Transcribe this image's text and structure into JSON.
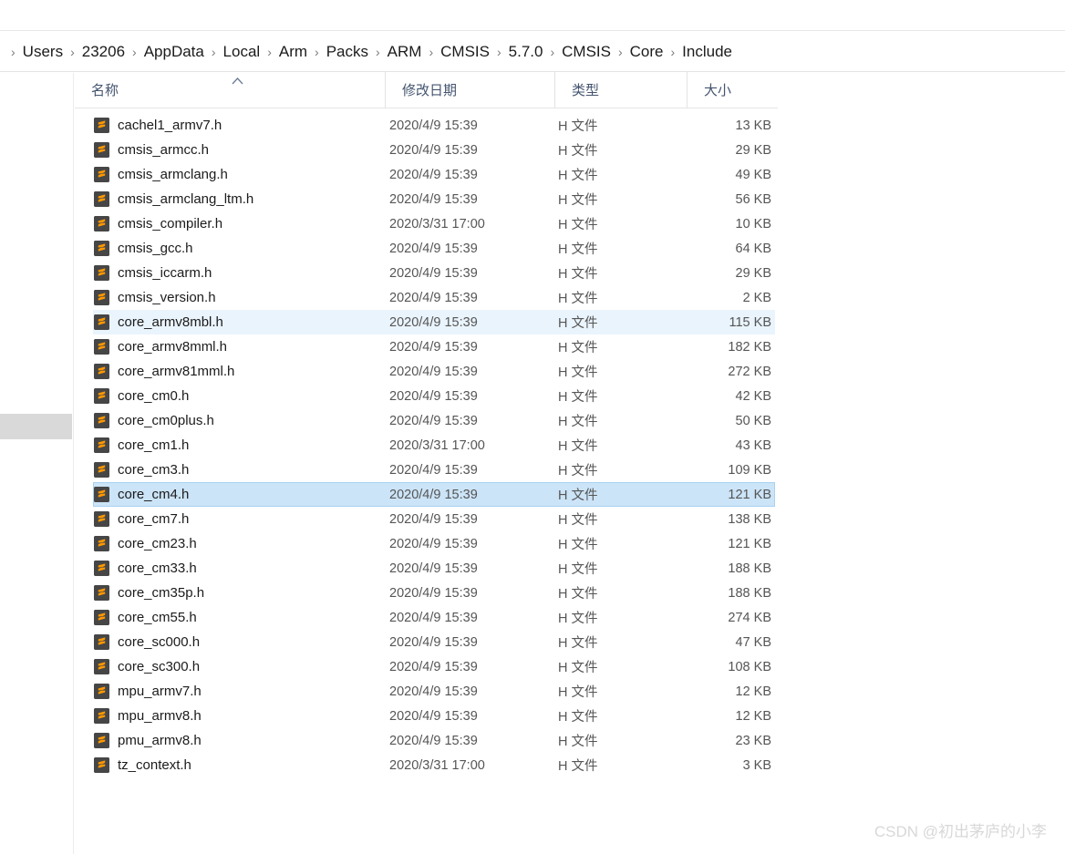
{
  "breadcrumb": {
    "separator": "›",
    "items": [
      {
        "label": "Users"
      },
      {
        "label": "23206"
      },
      {
        "label": "AppData"
      },
      {
        "label": "Local"
      },
      {
        "label": "Arm"
      },
      {
        "label": "Packs"
      },
      {
        "label": "ARM"
      },
      {
        "label": "CMSIS"
      },
      {
        "label": "5.7.0"
      },
      {
        "label": "CMSIS"
      },
      {
        "label": "Core"
      },
      {
        "label": "Include"
      }
    ]
  },
  "columns": {
    "name": "名称",
    "date": "修改日期",
    "type": "类型",
    "size": "大小",
    "sort_caret": "︿"
  },
  "colors": {
    "selection_bg": "#cce4f7",
    "selection_border": "#a8d2f0",
    "hover_bg": "#eaf4fd",
    "icon_bg": "#464646",
    "icon_glyph": "#ff9800",
    "header_text": "#44546f",
    "rail_block": "#d9d9d9"
  },
  "icons": {
    "file_icon_name": "sublime-text-file-icon"
  },
  "files": [
    {
      "name": "cachel1_armv7.h",
      "date": "2020/4/9 15:39",
      "type": "H 文件",
      "size": "13 KB",
      "state": "normal"
    },
    {
      "name": "cmsis_armcc.h",
      "date": "2020/4/9 15:39",
      "type": "H 文件",
      "size": "29 KB",
      "state": "normal"
    },
    {
      "name": "cmsis_armclang.h",
      "date": "2020/4/9 15:39",
      "type": "H 文件",
      "size": "49 KB",
      "state": "normal"
    },
    {
      "name": "cmsis_armclang_ltm.h",
      "date": "2020/4/9 15:39",
      "type": "H 文件",
      "size": "56 KB",
      "state": "normal"
    },
    {
      "name": "cmsis_compiler.h",
      "date": "2020/3/31 17:00",
      "type": "H 文件",
      "size": "10 KB",
      "state": "normal"
    },
    {
      "name": "cmsis_gcc.h",
      "date": "2020/4/9 15:39",
      "type": "H 文件",
      "size": "64 KB",
      "state": "normal"
    },
    {
      "name": "cmsis_iccarm.h",
      "date": "2020/4/9 15:39",
      "type": "H 文件",
      "size": "29 KB",
      "state": "normal"
    },
    {
      "name": "cmsis_version.h",
      "date": "2020/4/9 15:39",
      "type": "H 文件",
      "size": "2 KB",
      "state": "normal"
    },
    {
      "name": "core_armv8mbl.h",
      "date": "2020/4/9 15:39",
      "type": "H 文件",
      "size": "115 KB",
      "state": "hover"
    },
    {
      "name": "core_armv8mml.h",
      "date": "2020/4/9 15:39",
      "type": "H 文件",
      "size": "182 KB",
      "state": "normal"
    },
    {
      "name": "core_armv81mml.h",
      "date": "2020/4/9 15:39",
      "type": "H 文件",
      "size": "272 KB",
      "state": "normal"
    },
    {
      "name": "core_cm0.h",
      "date": "2020/4/9 15:39",
      "type": "H 文件",
      "size": "42 KB",
      "state": "normal"
    },
    {
      "name": "core_cm0plus.h",
      "date": "2020/4/9 15:39",
      "type": "H 文件",
      "size": "50 KB",
      "state": "normal"
    },
    {
      "name": "core_cm1.h",
      "date": "2020/3/31 17:00",
      "type": "H 文件",
      "size": "43 KB",
      "state": "normal"
    },
    {
      "name": "core_cm3.h",
      "date": "2020/4/9 15:39",
      "type": "H 文件",
      "size": "109 KB",
      "state": "normal"
    },
    {
      "name": "core_cm4.h",
      "date": "2020/4/9 15:39",
      "type": "H 文件",
      "size": "121 KB",
      "state": "selected"
    },
    {
      "name": "core_cm7.h",
      "date": "2020/4/9 15:39",
      "type": "H 文件",
      "size": "138 KB",
      "state": "normal"
    },
    {
      "name": "core_cm23.h",
      "date": "2020/4/9 15:39",
      "type": "H 文件",
      "size": "121 KB",
      "state": "normal"
    },
    {
      "name": "core_cm33.h",
      "date": "2020/4/9 15:39",
      "type": "H 文件",
      "size": "188 KB",
      "state": "normal"
    },
    {
      "name": "core_cm35p.h",
      "date": "2020/4/9 15:39",
      "type": "H 文件",
      "size": "188 KB",
      "state": "normal"
    },
    {
      "name": "core_cm55.h",
      "date": "2020/4/9 15:39",
      "type": "H 文件",
      "size": "274 KB",
      "state": "normal"
    },
    {
      "name": "core_sc000.h",
      "date": "2020/4/9 15:39",
      "type": "H 文件",
      "size": "47 KB",
      "state": "normal"
    },
    {
      "name": "core_sc300.h",
      "date": "2020/4/9 15:39",
      "type": "H 文件",
      "size": "108 KB",
      "state": "normal"
    },
    {
      "name": "mpu_armv7.h",
      "date": "2020/4/9 15:39",
      "type": "H 文件",
      "size": "12 KB",
      "state": "normal"
    },
    {
      "name": "mpu_armv8.h",
      "date": "2020/4/9 15:39",
      "type": "H 文件",
      "size": "12 KB",
      "state": "normal"
    },
    {
      "name": "pmu_armv8.h",
      "date": "2020/4/9 15:39",
      "type": "H 文件",
      "size": "23 KB",
      "state": "normal"
    },
    {
      "name": "tz_context.h",
      "date": "2020/3/31 17:00",
      "type": "H 文件",
      "size": "3 KB",
      "state": "normal"
    }
  ],
  "watermark": {
    "text": "CSDN @初出茅庐的小李"
  }
}
